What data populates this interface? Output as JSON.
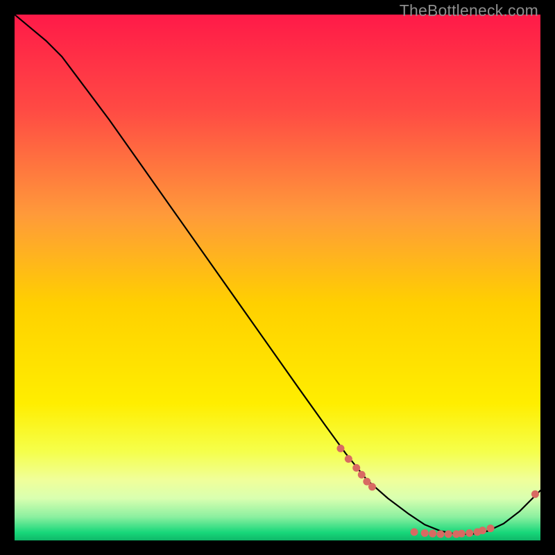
{
  "watermark": "TheBottleneck.com",
  "chart_data": {
    "type": "line",
    "title": "",
    "xlabel": "",
    "ylabel": "",
    "xlim": [
      0,
      100
    ],
    "ylim": [
      0,
      100
    ],
    "grid": false,
    "legend": false,
    "background_gradient": {
      "top": "#ff1a48",
      "mid_upper": "#ff7a3c",
      "mid": "#ffd000",
      "mid_lower": "#f5ff4a",
      "band": "#f0ff9a",
      "bottom": "#17d77a"
    },
    "series": [
      {
        "name": "curve",
        "color": "#000000",
        "x": [
          0,
          3,
          6,
          9,
          12,
          18,
          24,
          30,
          36,
          42,
          48,
          54,
          59,
          63,
          67,
          71,
          75,
          78,
          81,
          84,
          87,
          90,
          93,
          96,
          100
        ],
        "y": [
          100,
          97.5,
          95,
          92,
          88,
          80,
          71.5,
          63,
          54.5,
          46,
          37.5,
          29,
          22,
          16.5,
          11.5,
          8,
          5,
          3,
          1.8,
          1.2,
          1.2,
          1.8,
          3.2,
          5.5,
          9.5
        ]
      }
    ],
    "markers": {
      "name": "dots",
      "color": "#d86a62",
      "radius": 5.5,
      "points": [
        {
          "x": 62,
          "y": 17.5
        },
        {
          "x": 63.5,
          "y": 15.5
        },
        {
          "x": 65,
          "y": 13.8
        },
        {
          "x": 66,
          "y": 12.5
        },
        {
          "x": 67,
          "y": 11.2
        },
        {
          "x": 68,
          "y": 10.2
        },
        {
          "x": 76,
          "y": 1.6
        },
        {
          "x": 78,
          "y": 1.4
        },
        {
          "x": 79.5,
          "y": 1.3
        },
        {
          "x": 81,
          "y": 1.2
        },
        {
          "x": 82.5,
          "y": 1.2
        },
        {
          "x": 84,
          "y": 1.2
        },
        {
          "x": 85,
          "y": 1.3
        },
        {
          "x": 86.5,
          "y": 1.4
        },
        {
          "x": 88,
          "y": 1.6
        },
        {
          "x": 89,
          "y": 1.9
        },
        {
          "x": 90.5,
          "y": 2.3
        },
        {
          "x": 99,
          "y": 8.8
        }
      ]
    }
  }
}
